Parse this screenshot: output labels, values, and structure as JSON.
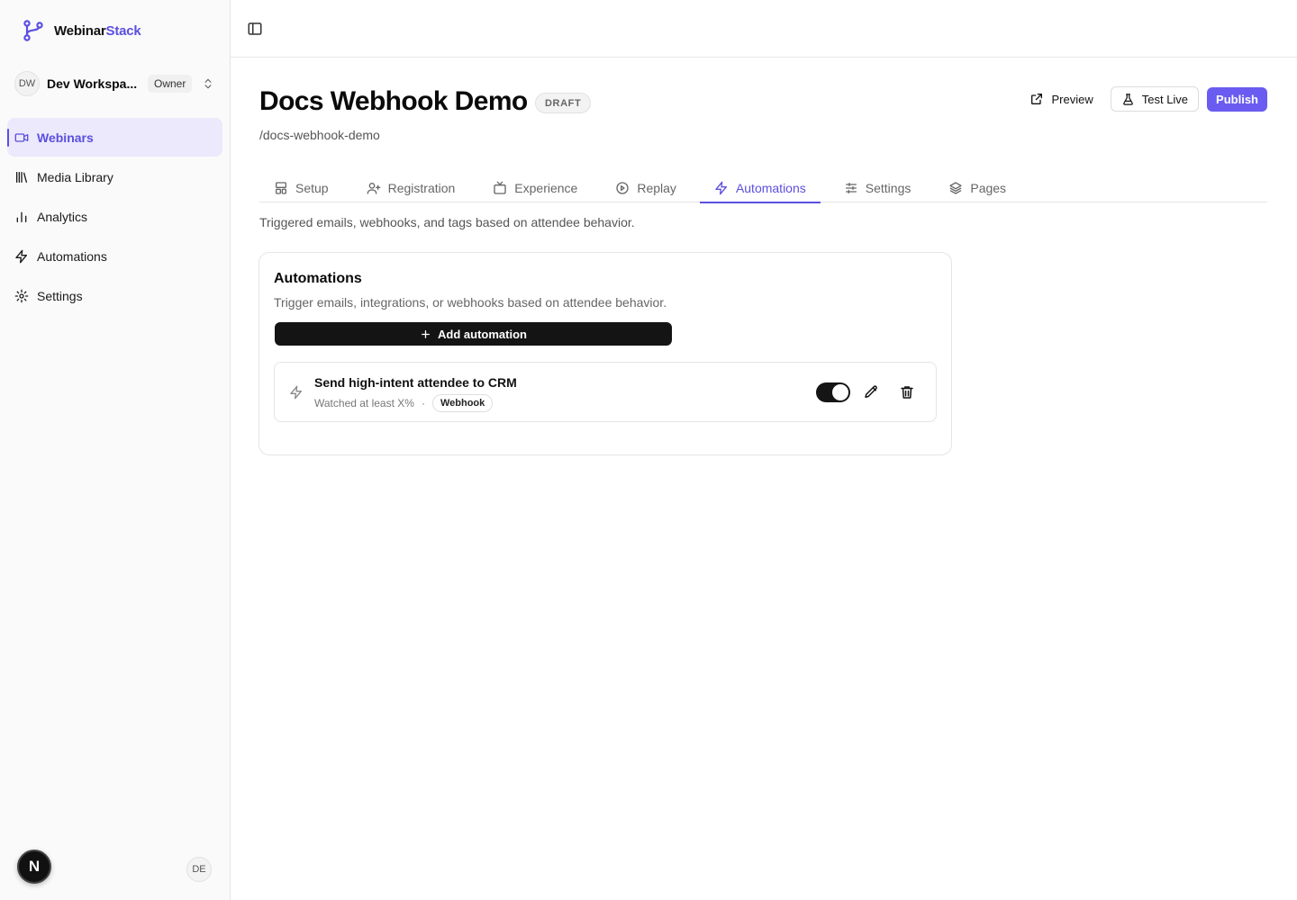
{
  "brand": {
    "name_main": "Webinar",
    "name_accent": "Stack",
    "accent_color": "#5b4fe0"
  },
  "workspace": {
    "initials": "DW",
    "name": "Dev Workspa...",
    "role": "Owner"
  },
  "sidebar": {
    "items": [
      {
        "label": "Webinars",
        "icon": "video-icon",
        "active": true
      },
      {
        "label": "Media Library",
        "icon": "library-icon",
        "active": false
      },
      {
        "label": "Analytics",
        "icon": "bar-chart-icon",
        "active": false
      },
      {
        "label": "Automations",
        "icon": "zap-icon",
        "active": false
      },
      {
        "label": "Settings",
        "icon": "gear-icon",
        "active": false
      }
    ]
  },
  "footer": {
    "n_badge": "N",
    "user_initials": "DE"
  },
  "header": {
    "title": "Docs Webhook Demo",
    "status_badge": "DRAFT",
    "slug": "/docs-webhook-demo",
    "preview_label": "Preview",
    "test_live_label": "Test Live",
    "publish_label": "Publish",
    "publish_color": "#6a5cf0"
  },
  "tabs": [
    {
      "label": "Setup",
      "icon": "layout-icon",
      "active": false
    },
    {
      "label": "Registration",
      "icon": "user-plus-icon",
      "active": false
    },
    {
      "label": "Experience",
      "icon": "tv-icon",
      "active": false
    },
    {
      "label": "Replay",
      "icon": "play-circle-icon",
      "active": false
    },
    {
      "label": "Automations",
      "icon": "zap-icon",
      "active": true
    },
    {
      "label": "Settings",
      "icon": "sliders-icon",
      "active": false
    },
    {
      "label": "Pages",
      "icon": "layers-icon",
      "active": false
    }
  ],
  "page_description": "Triggered emails, webhooks, and tags based on attendee behavior.",
  "automations_card": {
    "title": "Automations",
    "description": "Trigger emails, integrations, or webhooks based on attendee behavior.",
    "add_label": "Add automation",
    "items": [
      {
        "title": "Send high-intent attendee to CRM",
        "trigger": "Watched at least X%",
        "separator": "·",
        "type": "Webhook",
        "enabled": true
      }
    ]
  }
}
